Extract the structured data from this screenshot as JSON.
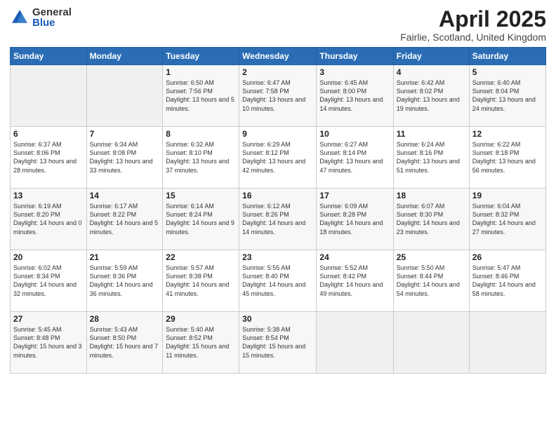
{
  "logo": {
    "general": "General",
    "blue": "Blue"
  },
  "title": "April 2025",
  "subtitle": "Fairlie, Scotland, United Kingdom",
  "weekdays": [
    "Sunday",
    "Monday",
    "Tuesday",
    "Wednesday",
    "Thursday",
    "Friday",
    "Saturday"
  ],
  "weeks": [
    [
      {
        "day": "",
        "info": ""
      },
      {
        "day": "",
        "info": ""
      },
      {
        "day": "1",
        "info": "Sunrise: 6:50 AM\nSunset: 7:56 PM\nDaylight: 13 hours and 5 minutes."
      },
      {
        "day": "2",
        "info": "Sunrise: 6:47 AM\nSunset: 7:58 PM\nDaylight: 13 hours and 10 minutes."
      },
      {
        "day": "3",
        "info": "Sunrise: 6:45 AM\nSunset: 8:00 PM\nDaylight: 13 hours and 14 minutes."
      },
      {
        "day": "4",
        "info": "Sunrise: 6:42 AM\nSunset: 8:02 PM\nDaylight: 13 hours and 19 minutes."
      },
      {
        "day": "5",
        "info": "Sunrise: 6:40 AM\nSunset: 8:04 PM\nDaylight: 13 hours and 24 minutes."
      }
    ],
    [
      {
        "day": "6",
        "info": "Sunrise: 6:37 AM\nSunset: 8:06 PM\nDaylight: 13 hours and 28 minutes."
      },
      {
        "day": "7",
        "info": "Sunrise: 6:34 AM\nSunset: 8:08 PM\nDaylight: 13 hours and 33 minutes."
      },
      {
        "day": "8",
        "info": "Sunrise: 6:32 AM\nSunset: 8:10 PM\nDaylight: 13 hours and 37 minutes."
      },
      {
        "day": "9",
        "info": "Sunrise: 6:29 AM\nSunset: 8:12 PM\nDaylight: 13 hours and 42 minutes."
      },
      {
        "day": "10",
        "info": "Sunrise: 6:27 AM\nSunset: 8:14 PM\nDaylight: 13 hours and 47 minutes."
      },
      {
        "day": "11",
        "info": "Sunrise: 6:24 AM\nSunset: 8:16 PM\nDaylight: 13 hours and 51 minutes."
      },
      {
        "day": "12",
        "info": "Sunrise: 6:22 AM\nSunset: 8:18 PM\nDaylight: 13 hours and 56 minutes."
      }
    ],
    [
      {
        "day": "13",
        "info": "Sunrise: 6:19 AM\nSunset: 8:20 PM\nDaylight: 14 hours and 0 minutes."
      },
      {
        "day": "14",
        "info": "Sunrise: 6:17 AM\nSunset: 8:22 PM\nDaylight: 14 hours and 5 minutes."
      },
      {
        "day": "15",
        "info": "Sunrise: 6:14 AM\nSunset: 8:24 PM\nDaylight: 14 hours and 9 minutes."
      },
      {
        "day": "16",
        "info": "Sunrise: 6:12 AM\nSunset: 8:26 PM\nDaylight: 14 hours and 14 minutes."
      },
      {
        "day": "17",
        "info": "Sunrise: 6:09 AM\nSunset: 8:28 PM\nDaylight: 14 hours and 18 minutes."
      },
      {
        "day": "18",
        "info": "Sunrise: 6:07 AM\nSunset: 8:30 PM\nDaylight: 14 hours and 23 minutes."
      },
      {
        "day": "19",
        "info": "Sunrise: 6:04 AM\nSunset: 8:32 PM\nDaylight: 14 hours and 27 minutes."
      }
    ],
    [
      {
        "day": "20",
        "info": "Sunrise: 6:02 AM\nSunset: 8:34 PM\nDaylight: 14 hours and 32 minutes."
      },
      {
        "day": "21",
        "info": "Sunrise: 5:59 AM\nSunset: 8:36 PM\nDaylight: 14 hours and 36 minutes."
      },
      {
        "day": "22",
        "info": "Sunrise: 5:57 AM\nSunset: 8:38 PM\nDaylight: 14 hours and 41 minutes."
      },
      {
        "day": "23",
        "info": "Sunrise: 5:55 AM\nSunset: 8:40 PM\nDaylight: 14 hours and 45 minutes."
      },
      {
        "day": "24",
        "info": "Sunrise: 5:52 AM\nSunset: 8:42 PM\nDaylight: 14 hours and 49 minutes."
      },
      {
        "day": "25",
        "info": "Sunrise: 5:50 AM\nSunset: 8:44 PM\nDaylight: 14 hours and 54 minutes."
      },
      {
        "day": "26",
        "info": "Sunrise: 5:47 AM\nSunset: 8:46 PM\nDaylight: 14 hours and 58 minutes."
      }
    ],
    [
      {
        "day": "27",
        "info": "Sunrise: 5:45 AM\nSunset: 8:48 PM\nDaylight: 15 hours and 3 minutes."
      },
      {
        "day": "28",
        "info": "Sunrise: 5:43 AM\nSunset: 8:50 PM\nDaylight: 15 hours and 7 minutes."
      },
      {
        "day": "29",
        "info": "Sunrise: 5:40 AM\nSunset: 8:52 PM\nDaylight: 15 hours and 11 minutes."
      },
      {
        "day": "30",
        "info": "Sunrise: 5:38 AM\nSunset: 8:54 PM\nDaylight: 15 hours and 15 minutes."
      },
      {
        "day": "",
        "info": ""
      },
      {
        "day": "",
        "info": ""
      },
      {
        "day": "",
        "info": ""
      }
    ]
  ]
}
